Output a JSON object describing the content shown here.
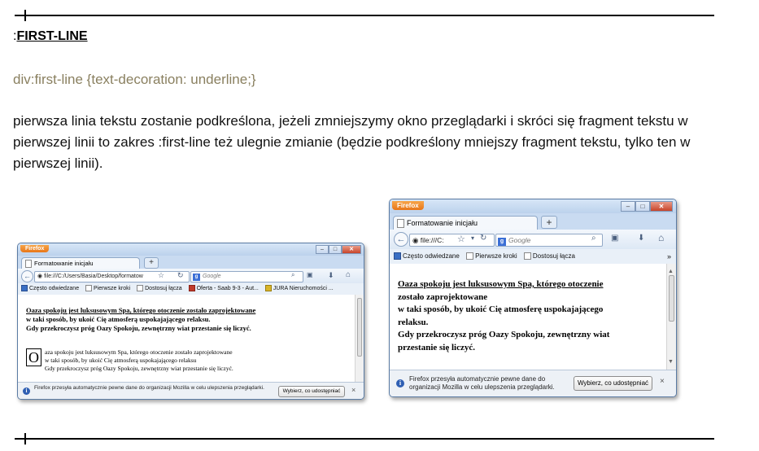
{
  "section": {
    "prefix": ":",
    "name": "FIRST-LINE"
  },
  "css_rule": "div:first-line {text-decoration: underline;}",
  "paragraph": "pierwsza linia tekstu zostanie podkreślona, jeżeli zmniejszymy okno przeglądarki i skróci się fragment tekstu w pierwszej linii to zakres :first-line też ulegnie zmianie (będzie podkreślony mniejszy fragment tekstu, tylko ten w pierwszej linii).",
  "browser_left": {
    "firefox_button": "Firefox",
    "tab_title": "Formatowanie inicjału",
    "new_tab": "+",
    "url": "file:///C:/Users/Basia/Desktop/formatow",
    "search_placeholder": "Google",
    "bookmarks": [
      "Często odwiedzane",
      "Pierwsze kroki",
      "Dostosuj łącza",
      "Oferta - Saab 9-3 - Aut...",
      "JURA Nieruchomości ..."
    ],
    "content_line1": "Oaza spokoju jest luksusowym Spa, którego otoczenie zostało zaprojektowane",
    "content_line2": "w taki sposób, by ukoić Cię atmosferą uspokajającego relaksu.",
    "content_line3": "Gdy przekroczysz próg Oazy Spokoju, zewnętrzny wiat przestanie się liczyć.",
    "dropcap": "O",
    "dropcap_line1": "aza spokoju jest luksusowym Spa, którego otoczenie zostało zaprojektowane",
    "dropcap_line2": "w taki sposób, by ukoić Cię atmosferą uspokajającego relaksu",
    "dropcap_line3": "Gdy przekroczysz próg Oazy Spokoju, zewnętrzny wiat przestanie się liczyć.",
    "notification": "Firefox przesyła automatycznie pewne dane do organizacji Mozilla w celu ulepszenia przeglądarki.",
    "notification_button": "Wybierz, co udostępniać",
    "notification_close": "×"
  },
  "browser_right": {
    "firefox_button": "Firefox",
    "tab_title": "Formatowanie inicjału",
    "new_tab": "+",
    "url": "file:///C:",
    "search_placeholder": "Google",
    "bookmarks": [
      "Często odwiedzane",
      "Pierwsze kroki",
      "Dostosuj łącza"
    ],
    "content_line1": "Oaza spokoju jest luksusowym Spa, którego otoczenie",
    "content_line2": "zostało zaprojektowane",
    "content_line3": "w taki sposób, by ukoić Cię atmosferę uspokajającego",
    "content_line4": "relaksu.",
    "content_line5": "Gdy przekroczysz próg Oazy Spokoju, zewnętrzny wiat",
    "content_line6": "przestanie się liczyć.",
    "notification": "Firefox przesyła automatycznie pewne dane do organizacji Mozilla w celu ulepszenia przeglądarki.",
    "notification_button": "Wybierz, co udostępniać",
    "notification_close": "×"
  }
}
